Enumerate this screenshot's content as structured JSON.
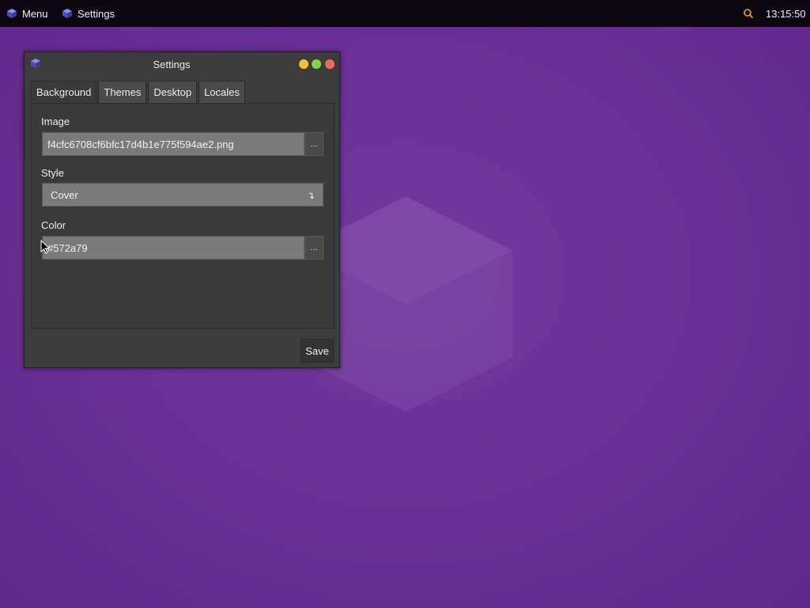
{
  "colors": {
    "topbar_bg": "#0c070f",
    "desktop_bg": "#6a2f95",
    "window_bg": "#3c3c3c",
    "input_bg": "#7a7a7a",
    "search_icon": "#f0a030",
    "win_minimize": "#f3c03a",
    "win_maximize": "#87d04a",
    "win_close": "#ee6a5e"
  },
  "topbar": {
    "menu_label": "Menu",
    "menu_icon": "cube-icon",
    "app_label": "Settings",
    "app_icon": "cube-icon",
    "search_icon": "search-icon",
    "clock": "13:15:50"
  },
  "window": {
    "title": "Settings",
    "icon": "cube-icon",
    "tabs": [
      {
        "label": "Background",
        "active": true
      },
      {
        "label": "Themes",
        "active": false
      },
      {
        "label": "Desktop",
        "active": false
      },
      {
        "label": "Locales",
        "active": false
      }
    ],
    "background": {
      "image_label": "Image",
      "image_value": "f4cfc6708cf6bfc17d4b1e775f594ae2.png",
      "image_browse": "...",
      "style_label": "Style",
      "style_value": "Cover",
      "style_arrow": "↴",
      "color_label": "Color",
      "color_value": "#572a79",
      "color_browse": "..."
    },
    "save_label": "Save"
  }
}
